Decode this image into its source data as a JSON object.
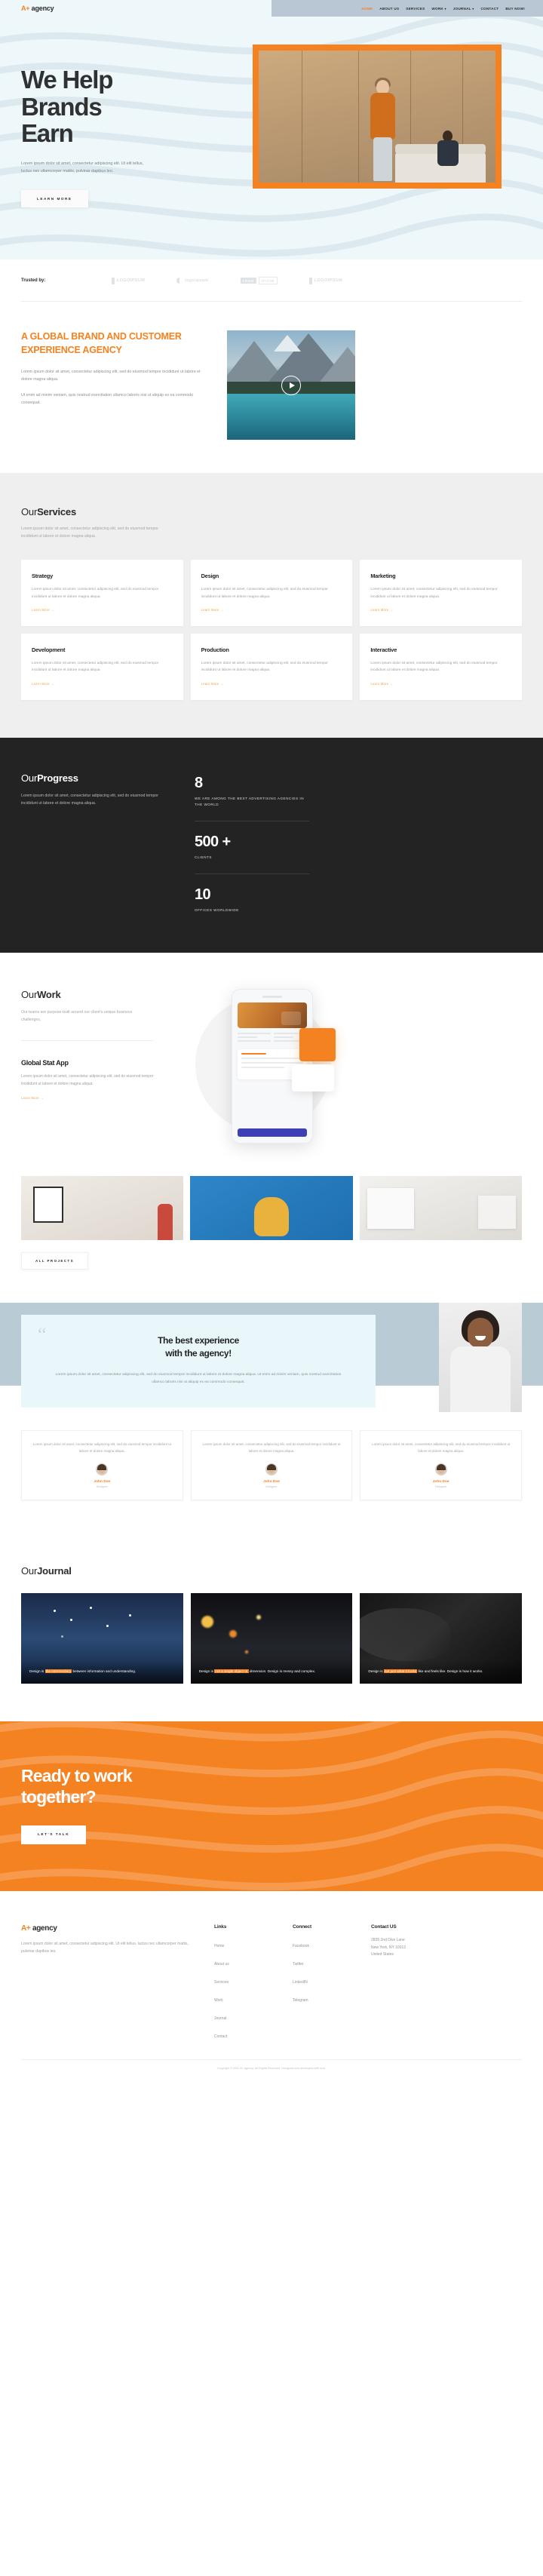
{
  "header": {
    "logo": {
      "mark": "A+",
      "name": "agency"
    },
    "nav": [
      {
        "label": "HOME",
        "active": true,
        "caret": false
      },
      {
        "label": "ABOUT US",
        "active": false,
        "caret": false
      },
      {
        "label": "SERVICES",
        "active": false,
        "caret": false
      },
      {
        "label": "WORK",
        "active": false,
        "caret": true
      },
      {
        "label": "JOURNAL",
        "active": false,
        "caret": true
      },
      {
        "label": "CONTACT",
        "active": false,
        "caret": false
      },
      {
        "label": "BUY NOW!",
        "active": false,
        "caret": false
      }
    ]
  },
  "hero": {
    "title_line1": "We Help",
    "title_line2": "Brands",
    "title_line3": "Earn",
    "subtitle": "Lorem ipsum dolor sit amet, consectetur adipiscing elit. Ut elit tellus, luctus nec ullamcorper mattis, pulvinar dapibus leo.",
    "cta_label": "LEARN MORE",
    "accent_color": "#f58220",
    "bg_color": "#eef7f9"
  },
  "trusted": {
    "label": "Trusted by:",
    "logos": [
      {
        "text": "LOGOIPSUM",
        "style": "mark"
      },
      {
        "text": "logoipsum",
        "style": "circle"
      },
      {
        "text_a": "LOGO",
        "text_b": "IPSUM",
        "style": "box"
      },
      {
        "text": "LOGOIPSUM",
        "style": "mark"
      }
    ]
  },
  "global": {
    "title": "A GLOBAL BRAND AND CUSTOMER EXPERIENCE AGENCY",
    "paragraph1": "Lorem ipsum dolor sit amet, consectetur adipiscing elit, sed do eiusmod tempor incididunt ut labore et dolore magna aliqua.",
    "paragraph2": "Ut enim ad minim veniam, quis nostrud exercitation ullamco laboris nisi ut aliquip ex ea commodo consequat.",
    "video_play_label": "play-video"
  },
  "services": {
    "title_light": "Our",
    "title_bold": "Services",
    "subtitle": "Lorem ipsum dolor sit amet, consectetur adipiscing elit, sed do eiusmod tempor incididunt ut labore et dolore magna aliqua.",
    "learn_more": "Learn More  →",
    "cards": [
      {
        "name": "Strategy",
        "desc": "Lorem ipsum dolor sit amet, consectetur adipiscing elit, sed do eiusmod tempor incididunt ut labore et dolore magna aliqua."
      },
      {
        "name": "Design",
        "desc": "Lorem ipsum dolor sit amet, consectetur adipiscing elit, sed do eiusmod tempor incididunt ut labore et dolore magna aliqua."
      },
      {
        "name": "Marketing",
        "desc": "Lorem ipsum dolor sit amet, consectetur adipiscing elit, sed do eiusmod tempor incididunt ut labore et dolore magna aliqua."
      },
      {
        "name": "Development",
        "desc": "Lorem ipsum dolor sit amet, consectetur adipiscing elit, sed do eiusmod tempor incididunt ut labore et dolore magna aliqua."
      },
      {
        "name": "Production",
        "desc": "Lorem ipsum dolor sit amet, consectetur adipiscing elit, sed do eiusmod tempor incididunt ut labore et dolore magna aliqua."
      },
      {
        "name": "Interactive",
        "desc": "Lorem ipsum dolor sit amet, consectetur adipiscing elit, sed do eiusmod tempor incididunt ut labore et dolore magna aliqua."
      }
    ]
  },
  "progress": {
    "title_light": "Our",
    "title_bold": "Progress",
    "subtitle": "Lorem ipsum dolor sit amet, consectetur adipiscing elit, sed do eiusmod tempor incididunt ut labore et dolore magna aliqua.",
    "stats": [
      {
        "value": "8",
        "label": "WE ARE AMONG THE BEST ADVERTISING AGENCIES IN THE WORLD"
      },
      {
        "value": "500 +",
        "label": "CLIENTS"
      },
      {
        "value": "10",
        "label": "OFFICES WORLDWIDE"
      }
    ]
  },
  "work": {
    "title_light": "Our",
    "title_bold": "Work",
    "subtitle": "Our teams are purpose-built around our client's unique business challenges,",
    "project_name": "Global Stat App",
    "project_desc": "Lorem ipsum dolor sit amet, consectetur adipiscing elit, sed do eiusmod tempor incididunt ut labore et dolore magna aliqua.",
    "learn_more": "Learn More  →",
    "all_projects_label": "ALL PROJECTS",
    "gallery": [
      {
        "alt": "framed-art-in-gallery"
      },
      {
        "alt": "dog-on-blue-background"
      },
      {
        "alt": "newspaper-on-desk"
      }
    ]
  },
  "testimonial": {
    "heading_line1": "The best experience",
    "heading_line2": "with the agency!",
    "body": "Lorem ipsum dolor sit amet, consectetur adipiscing elit, sed do eiusmod tempor incididunt ut labore et dolore magna aliqua. Ut enim ad minim veniam, quis nostrud exercitation ullamco laboris nisi ut aliquip ex ea commodo consequat.",
    "quote_glyph": "“",
    "cards": [
      {
        "text": "Lorem ipsum dolor sit amet, consectetur adipiscing elit, sed do eiusmod tempor incididunt ut labore et dolore magna aliqua.",
        "name": "John Doe",
        "role": "Designer"
      },
      {
        "text": "Lorem ipsum dolor sit amet, consectetur adipiscing elit, sed do eiusmod tempor incididunt ut labore et dolore magna aliqua.",
        "name": "John Doe",
        "role": "Designer"
      },
      {
        "text": "Lorem ipsum dolor sit amet, consectetur adipiscing elit, sed do eiusmod tempor incididunt ut labore et dolore magna aliqua.",
        "name": "John Doe",
        "role": "Designer"
      }
    ]
  },
  "journal": {
    "title_light": "Our",
    "title_bold": "Journal",
    "posts": [
      {
        "caption_pre": "Design is ",
        "caption_hl": "the intermediary",
        "caption_post": " between information and understanding."
      },
      {
        "caption_pre": "Design is ",
        "caption_hl": "not a single object or",
        "caption_post": " dimension. Design is messy and complex."
      },
      {
        "caption_pre": "Design is ",
        "caption_hl": "not just what it looks",
        "caption_post": " like and feels like. Design is how it works."
      }
    ]
  },
  "cta": {
    "title_line1": "Ready to work",
    "title_line2": "together?",
    "button_label": "LET'S TALK",
    "bg_color": "#f58220"
  },
  "footer": {
    "logo": {
      "mark": "A+",
      "name": "agency"
    },
    "description": "Lorem ipsum dolor sit amet, consectetur adipiscing elit. Ut elit tellus, luctus nec ullamcorper mattis, pulvinar dapibus leo.",
    "links": {
      "title": "Links",
      "items": [
        "Home",
        "About us",
        "Services",
        "Work",
        "Journal",
        "Contact"
      ]
    },
    "connect": {
      "title": "Connect",
      "items": [
        "Facebook",
        "Twitter",
        "LinkedIN",
        "Telegram"
      ]
    },
    "contact": {
      "title": "Contact US",
      "address_line1": "2835 2nd Dive Lane",
      "address_line2": "New York, NY 10013",
      "address_line3": "United States"
    },
    "copyright": "Copyright © 2022 A+ agency. All Rights Reserved. Designed and developed with love."
  }
}
